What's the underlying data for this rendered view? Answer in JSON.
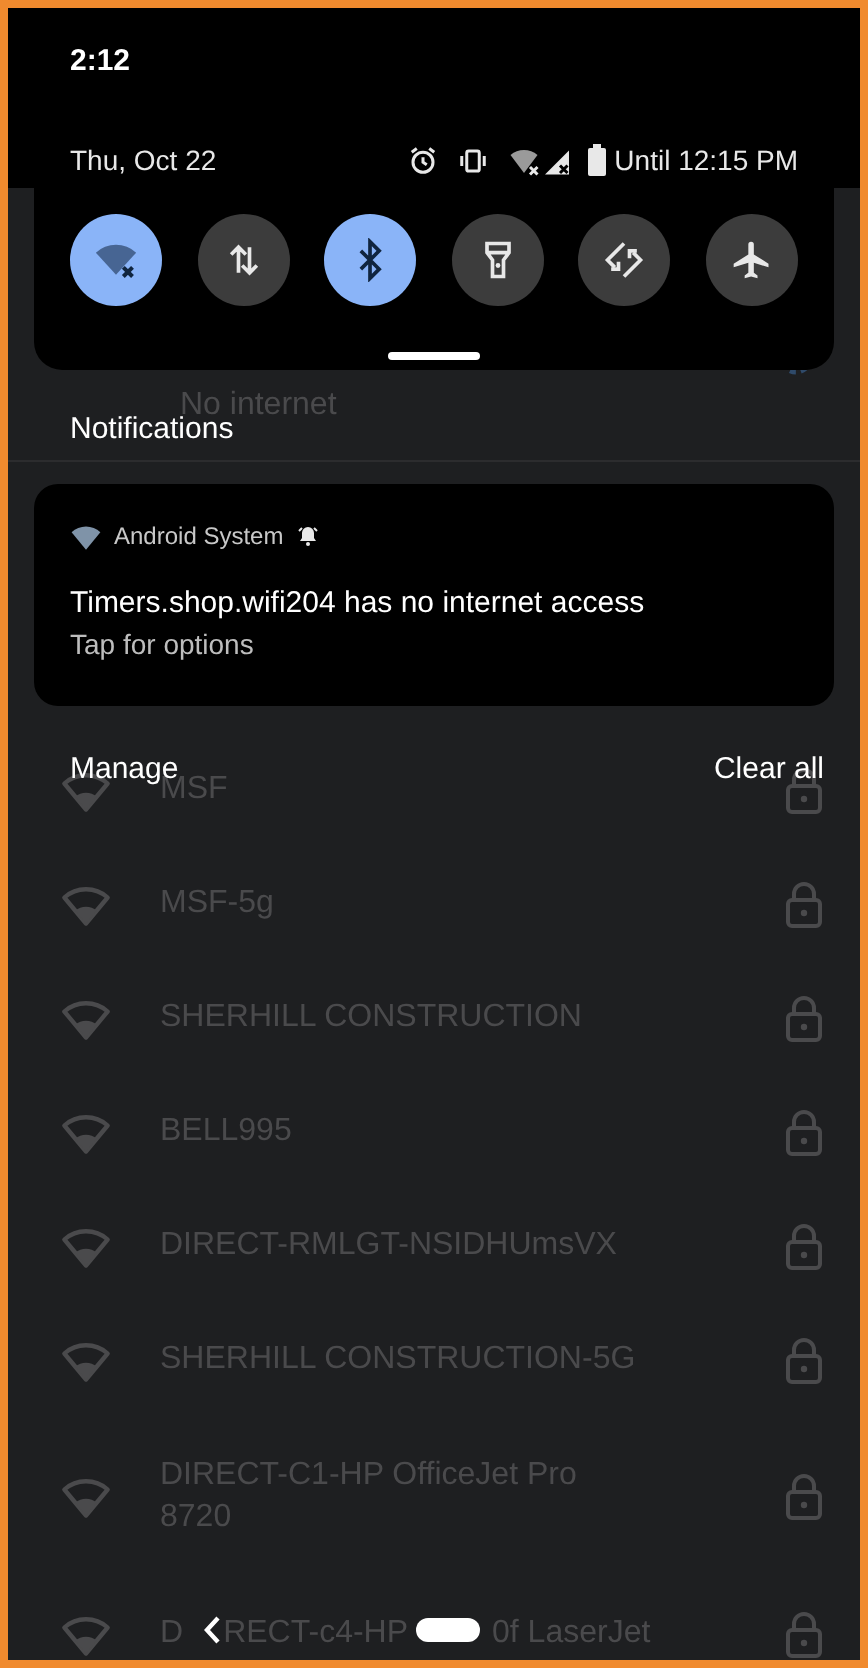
{
  "status_bar": {
    "time": "2:12"
  },
  "quick_settings": {
    "date": "Thu, Oct 22",
    "battery_text": "Until 12:15 PM",
    "tiles": [
      {
        "kind": "wifi",
        "on": true
      },
      {
        "kind": "data",
        "on": false
      },
      {
        "kind": "bluetooth",
        "on": true
      },
      {
        "kind": "flashlight",
        "on": false
      },
      {
        "kind": "rotate",
        "on": false
      },
      {
        "kind": "airplane",
        "on": false
      }
    ]
  },
  "notifications": {
    "title": "Notifications",
    "items": [
      {
        "app": "Android System",
        "title": "Timers.shop.wifi204 has no internet access",
        "text": "Tap for options"
      }
    ],
    "manage": "Manage",
    "clear_all": "Clear all"
  },
  "wifi_list": {
    "current_status": "No internet",
    "networks": [
      {
        "name": "MSF",
        "locked": true
      },
      {
        "name": "MSF-5g",
        "locked": true
      },
      {
        "name": "SHERHILL CONSTRUCTION",
        "locked": true
      },
      {
        "name": "BELL995",
        "locked": true
      },
      {
        "name": "DIRECT-RMLGT-NSIDHUmsVX",
        "locked": true
      },
      {
        "name": "SHERHILL CONSTRUCTION-5G",
        "locked": true
      },
      {
        "name": "DIRECT-C1-HP OfficeJet Pro 8720",
        "locked": true
      },
      {
        "name_parts": [
          "D",
          "RECT-c4-HP",
          "0f LaserJet"
        ],
        "locked": true
      }
    ]
  }
}
